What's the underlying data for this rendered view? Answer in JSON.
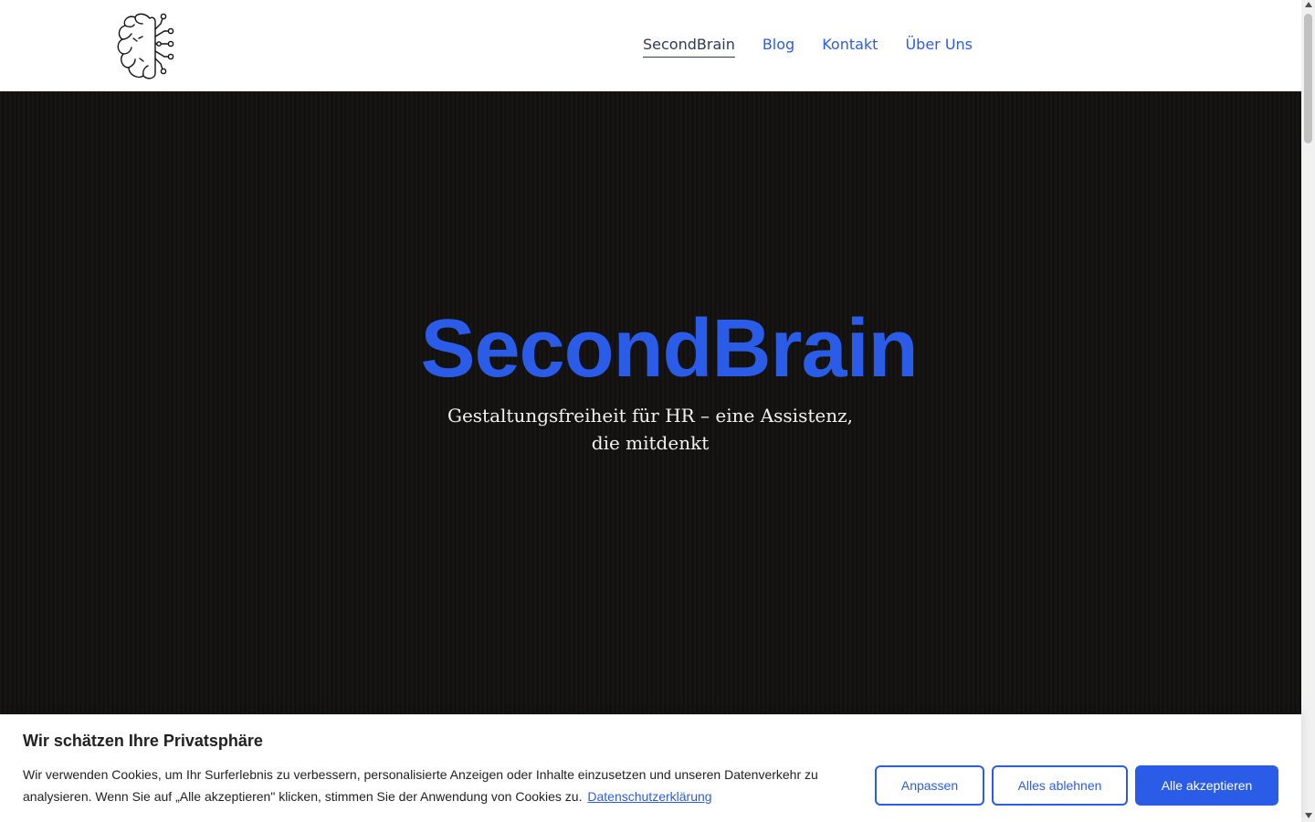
{
  "brand": {
    "logo_icon": "brain-circuit-icon",
    "accent": "#2b5ce8"
  },
  "nav": {
    "items": [
      {
        "label": "SecondBrain",
        "active": true
      },
      {
        "label": "Blog"
      },
      {
        "label": "Kontakt"
      },
      {
        "label": "Über Uns"
      }
    ]
  },
  "hero": {
    "title": "SecondBrain",
    "subtitle": "Gestaltungsfreiheit für HR – eine Assistenz, die mitdenkt"
  },
  "cookie_banner": {
    "title": "Wir schätzen Ihre Privatsphäre",
    "text": "Wir verwenden Cookies, um Ihr Surferlebnis zu verbessern, personalisierte Anzeigen oder Inhalte einzusetzen und unseren Datenverkehr zu analysieren. Wenn Sie auf „Alle akzeptieren\" klicken, stimmen Sie der Anwendung von Cookies zu.",
    "privacy_link": "Datenschutzerklärung",
    "buttons": {
      "customize": "Anpassen",
      "reject_all": "Alles ablehnen",
      "accept_all": "Alle akzeptieren"
    }
  }
}
